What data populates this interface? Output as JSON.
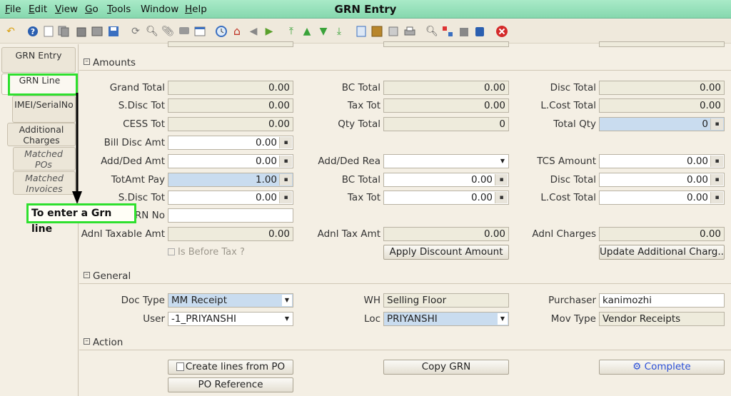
{
  "window": {
    "title": "GRN Entry"
  },
  "menu": [
    {
      "label": "File",
      "u": "F"
    },
    {
      "label": "Edit",
      "u": "E"
    },
    {
      "label": "View",
      "u": "V"
    },
    {
      "label": "Go",
      "u": "G"
    },
    {
      "label": "Tools",
      "u": "T"
    },
    {
      "label": "Window",
      "u": ""
    },
    {
      "label": "Help",
      "u": "H"
    }
  ],
  "left_tabs": {
    "grn_entry": "GRN Entry",
    "grn_line": "GRN Line",
    "imei": "IMEI/SerialNo",
    "additional_charges": "Additional Charges",
    "matched_pos": "Matched POs",
    "matched_invoices": "Matched Invoices"
  },
  "sections": {
    "amounts": "Amounts",
    "general": "General",
    "action": "Action"
  },
  "amounts": {
    "grand_total": {
      "label": "Grand Total",
      "value": "0.00"
    },
    "bc_total": {
      "label": "BC Total",
      "value": "0.00"
    },
    "disc_total": {
      "label": "Disc Total",
      "value": "0.00"
    },
    "s_disc_tot": {
      "label": "S.Disc Tot",
      "value": "0.00"
    },
    "tax_tot": {
      "label": "Tax Tot",
      "value": "0.00"
    },
    "l_cost_total": {
      "label": "L.Cost Total",
      "value": "0.00"
    },
    "cess_tot": {
      "label": "CESS Tot",
      "value": "0.00"
    },
    "qty_total": {
      "label": "Qty Total",
      "value": "0"
    },
    "total_qty": {
      "label": "Total Qty",
      "value": "0"
    },
    "bill_disc_amt": {
      "label": "Bill Disc Amt",
      "value": "0.00"
    },
    "add_ded_amt": {
      "label": "Add/Ded Amt",
      "value": "0.00"
    },
    "add_ded_rea": {
      "label": "Add/Ded Rea",
      "value": ""
    },
    "tcs_amount": {
      "label": "TCS Amount",
      "value": "0.00"
    },
    "totamt_pay": {
      "label": "TotAmt Pay",
      "value": "1.00"
    },
    "bc_total2": {
      "label": "BC Total",
      "value": "0.00"
    },
    "disc_total2": {
      "label": "Disc Total",
      "value": "0.00"
    },
    "s_disc_tot2": {
      "label": "S.Disc Tot",
      "value": "0.00"
    },
    "tax_tot2": {
      "label": "Tax Tot",
      "value": "0.00"
    },
    "l_cost_total2": {
      "label": "L.Cost Total",
      "value": "0.00"
    },
    "rn_no": {
      "label": "RN No",
      "value": ""
    },
    "adnl_taxable_amt": {
      "label": "Adnl Taxable Amt",
      "value": "0.00"
    },
    "adnl_tax_amt": {
      "label": "Adnl Tax Amt",
      "value": "0.00"
    },
    "adnl_charges": {
      "label": "Adnl Charges",
      "value": "0.00"
    },
    "is_before_tax": "Is Before Tax ?",
    "apply_discount_btn": "Apply Discount Amount",
    "update_additional_btn": "Update Additional Charg..."
  },
  "general": {
    "doc_type": {
      "label": "Doc Type",
      "value": "MM Receipt"
    },
    "wh": {
      "label": "WH",
      "value": "Selling Floor"
    },
    "purchaser": {
      "label": "Purchaser",
      "value": "kanimozhi"
    },
    "user": {
      "label": "User",
      "value": "-1_PRIYANSHI"
    },
    "loc": {
      "label": "Loc",
      "value": "PRIYANSHI"
    },
    "mov_type": {
      "label": "Mov Type",
      "value": "Vendor Receipts"
    }
  },
  "action": {
    "create_lines": "Create lines from PO",
    "copy_grn": "Copy GRN",
    "complete": "Complete",
    "po_reference": "PO Reference"
  },
  "annotation": {
    "text": "To enter a Grn line"
  },
  "colors": {
    "title_bar": "#a9eac8",
    "highlight": "#2ee02e",
    "blue_field": "#c9dcef",
    "complete_text": "#2a4fd8"
  }
}
